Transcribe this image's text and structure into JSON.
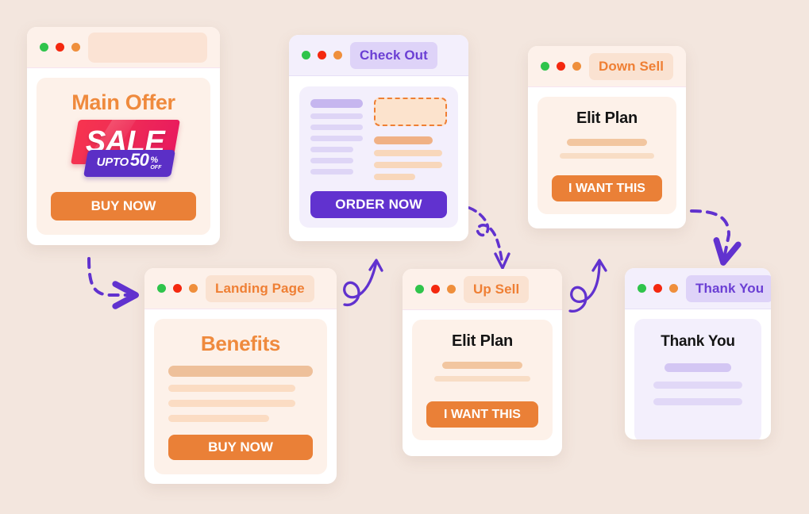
{
  "page": {
    "background_color": "#f3e6de",
    "accent_orange": "#ea8037",
    "accent_violet": "#6132cf",
    "title_orange": "#ef8a3d"
  },
  "cards": {
    "main_offer": {
      "title_bar_label": "",
      "heading": "Main Offer",
      "sale_badge": {
        "sale_text": "SALE",
        "upto_word": "UPTO",
        "upto_number": "50",
        "percent": "%",
        "off": "OFF"
      },
      "button_label": "BUY NOW"
    },
    "check_out": {
      "title_bar_label": "Check Out",
      "button_label": "ORDER NOW"
    },
    "down_sell": {
      "title_bar_label": "Down Sell",
      "heading": "Elit Plan",
      "button_label": "I WANT THIS"
    },
    "landing_page": {
      "title_bar_label": "Landing Page",
      "heading": "Benefits",
      "button_label": "BUY NOW"
    },
    "up_sell": {
      "title_bar_label": "Up Sell",
      "heading": "Elit Plan",
      "button_label": "I WANT THIS"
    },
    "thank_you": {
      "title_bar_label": "Thank You",
      "heading": "Thank You"
    }
  },
  "window_dots": {
    "green": "#2fc44b",
    "red": "#f4280f",
    "orange": "#ef8f3c"
  },
  "arrows": {
    "color": "#6132cf",
    "items": [
      {
        "name": "main-offer-to-landing-page",
        "style": "dashed"
      },
      {
        "name": "landing-page-to-check-out",
        "style": "solid-curl"
      },
      {
        "name": "check-out-to-up-sell",
        "style": "dashed-curl"
      },
      {
        "name": "up-sell-to-down-sell",
        "style": "solid-curl"
      },
      {
        "name": "down-sell-to-thank-you",
        "style": "dashed"
      }
    ]
  }
}
